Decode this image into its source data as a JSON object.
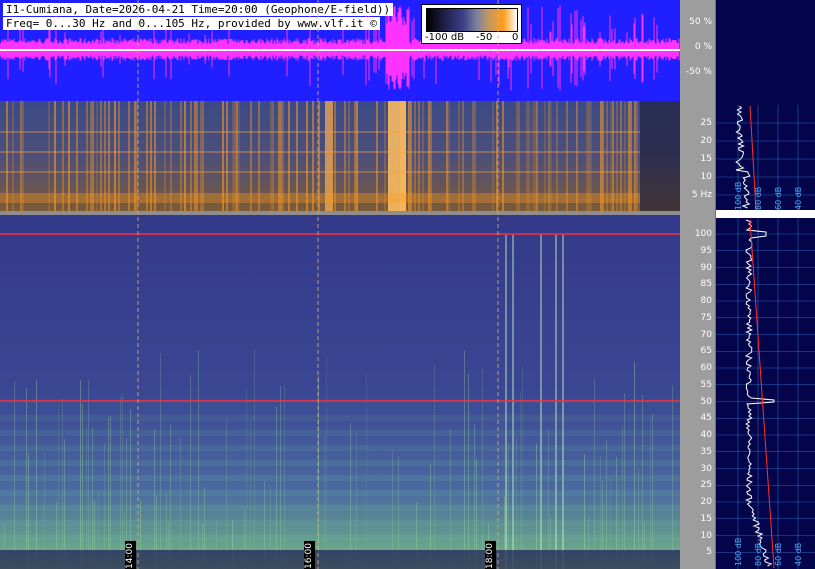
{
  "header": {
    "line1": "I1-Cumiana, Date=2026-04-21 Time=20:00 (Geophone/E-field))",
    "line2": "Freq= 0...30 Hz and 0...105 Hz, provided by www.vlf.it ©"
  },
  "colorbar": {
    "label_left": "-100 dB",
    "label_mid": "-50",
    "label_right": "0"
  },
  "amplitude_scale": [
    "50 %",
    "0 %",
    "-50 %"
  ],
  "freq_scale_top": [
    "25",
    "20",
    "15",
    "10",
    "5 Hz"
  ],
  "freq_scale_bottom": [
    "100",
    "95",
    "90",
    "85",
    "80",
    "75",
    "70",
    "65",
    "60",
    "55",
    "50",
    "45",
    "40",
    "35",
    "30",
    "25",
    "20",
    "15",
    "10",
    "5"
  ],
  "time_markers": [
    "14:00",
    "16:00",
    "18:00"
  ],
  "profile_labels_top": [
    "100 dB",
    "80 dB",
    "60 dB",
    "40 dB",
    "20 dB"
  ],
  "profile_labels_bottom": [
    "100 dB",
    "80 dB",
    "60 dB",
    "40 dB",
    "20 dB"
  ],
  "colors": {
    "waveform_bg": "#1f1fff",
    "waveform_trace": "#ff33ff",
    "spectrogram_low": "#2b3a8a",
    "spectrogram_high": "#ff9b1c",
    "profile_bg": "#04044a",
    "grid": "#3fa0ff",
    "marker_line": "#e0b070"
  }
}
